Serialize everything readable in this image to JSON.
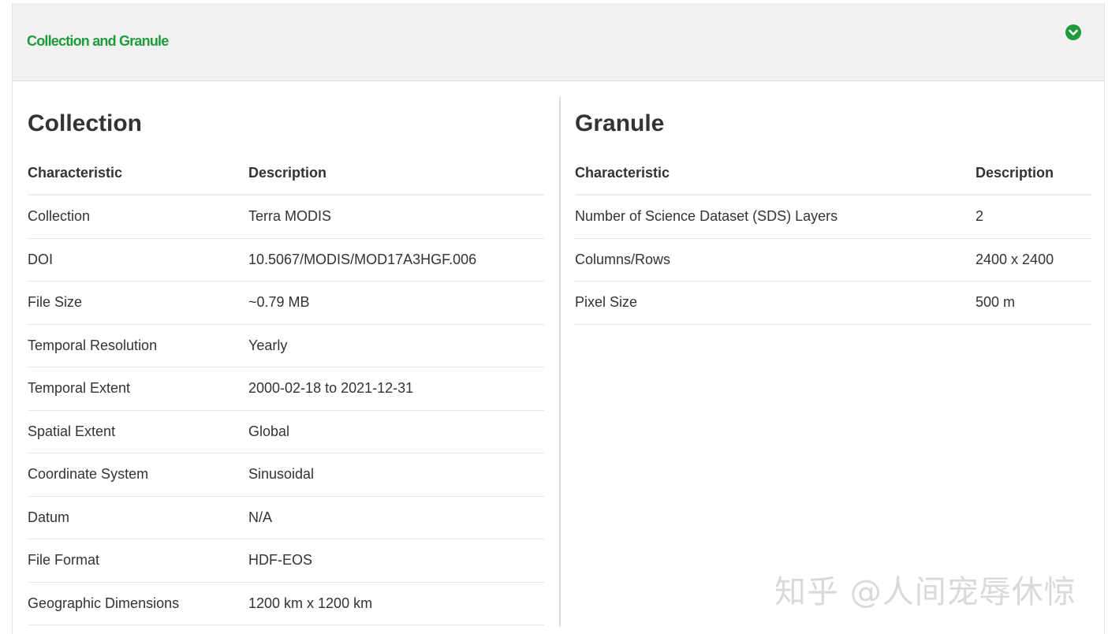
{
  "panel": {
    "title": "Collection and Granule"
  },
  "collection": {
    "title": "Collection",
    "headers": [
      "Characteristic",
      "Description"
    ],
    "rows": [
      [
        "Collection",
        "Terra MODIS"
      ],
      [
        "DOI",
        "10.5067/MODIS/MOD17A3HGF.006"
      ],
      [
        "File Size",
        "~0.79 MB"
      ],
      [
        "Temporal Resolution",
        "Yearly"
      ],
      [
        "Temporal Extent",
        "2000-02-18 to 2021-12-31"
      ],
      [
        "Spatial Extent",
        "Global"
      ],
      [
        "Coordinate System",
        "Sinusoidal"
      ],
      [
        "Datum",
        "N/A"
      ],
      [
        "File Format",
        "HDF-EOS"
      ],
      [
        "Geographic Dimensions",
        "1200 km x 1200 km"
      ]
    ]
  },
  "granule": {
    "title": "Granule",
    "headers": [
      "Characteristic",
      "Description"
    ],
    "rows": [
      [
        "Number of Science Dataset (SDS) Layers",
        "2"
      ],
      [
        "Columns/Rows",
        "2400 x 2400"
      ],
      [
        "Pixel Size",
        "500 m"
      ]
    ]
  },
  "watermark": "知乎 @人间宠辱休惊",
  "icons": {
    "toggle": "chevron-down-circle-icon"
  },
  "colors": {
    "accent": "#1e9b3a",
    "header_bg": "#f1f1f1"
  }
}
